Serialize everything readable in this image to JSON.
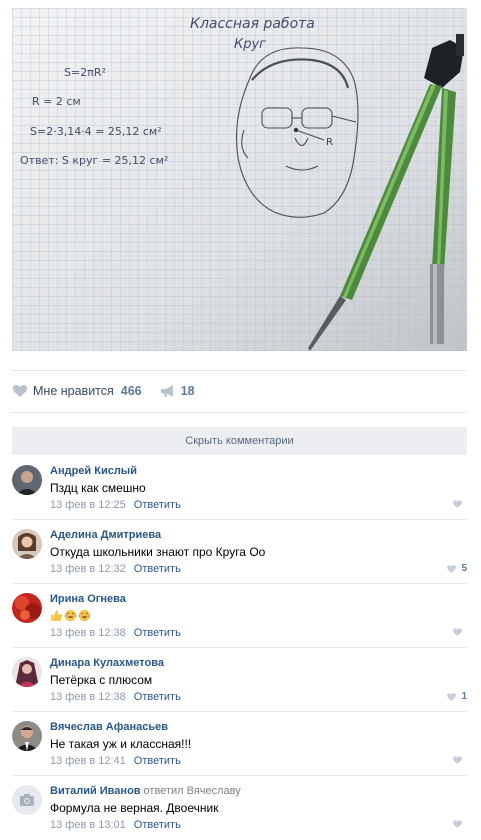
{
  "photo": {
    "title_line1": "Классная работа",
    "title_line2": "Круг",
    "formula": "S=2πR²",
    "radius": "R = 2 см",
    "calc": "S=2·3,14·4 = 25,12 см²",
    "answer": "Ответ: S круг = 25,12 см²",
    "face_label": "R"
  },
  "actions": {
    "like_label": "Мне нравится",
    "like_count": "466",
    "share_count": "18"
  },
  "hide_comments_label": "Скрыть комментарии",
  "reply_label": "Ответить",
  "comments": [
    {
      "author": "Андрей Кислый",
      "text": "Пздц как смешно",
      "time": "13 фев в 12:25",
      "likes": ""
    },
    {
      "author": "Аделина Дмитриева",
      "text": "Откуда школьники знают про Круга Оо",
      "time": "13 фев в 12:32",
      "likes": "5"
    },
    {
      "author": "Ирина Огнева",
      "text": "",
      "time": "13 фев в 12:38",
      "likes": ""
    },
    {
      "author": "Динара Кулахметова",
      "text": "Петёрка с плюсом",
      "time": "13 фев в 12:38",
      "likes": "1"
    },
    {
      "author": "Вячеслав Афанасьев",
      "text": "Не такая уж и классная!!!",
      "time": "13 фев в 12:41",
      "likes": ""
    },
    {
      "author": "Виталий Иванов",
      "replied": "ответил Вячеславу",
      "text": "Формула не верная. Двоечник",
      "time": "13 фев в 13:01",
      "likes": ""
    }
  ],
  "colors": {
    "link": "#2a5885",
    "meta": "#8c9aab",
    "like_count": "#5b7a9c",
    "hide_bar": "#eceef1"
  },
  "icons": [
    "heart-icon",
    "share-icon",
    "camera-icon",
    "thumbs-up-emoji",
    "laughing-emoji"
  ]
}
